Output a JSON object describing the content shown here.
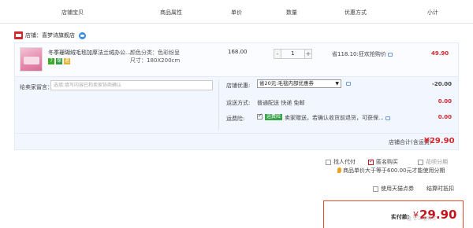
{
  "header": {
    "col_item": "店铺宝贝",
    "col_attr": "商品属性",
    "col_price": "单价",
    "col_qty": "数量",
    "col_discount": "优惠方式",
    "col_subtotal": "小计"
  },
  "store": {
    "label": "店铺：喜梦诗旗舰店"
  },
  "item": {
    "title": "冬季珊瑚绒毛毯加厚法兰绒办公...",
    "badges": [
      "7",
      "保",
      "退"
    ],
    "color": "颜色分类：色彩纷呈",
    "size": "尺寸：180X200cm",
    "price": "168.00",
    "qty_minus": "-",
    "qty_value": "1",
    "qty_plus": "+",
    "saving": "省118.10:狂欢抢购价",
    "subtotal": "49.90"
  },
  "message": {
    "label": "给卖家留言：",
    "placeholder": "选填:填写内容已和卖家协商确认"
  },
  "coupon": {
    "label": "店铺优惠:",
    "selected": "省20元:毛毯内部优惠券",
    "amount": "-20.00"
  },
  "shipping": {
    "label": "运送方式:",
    "text": "普通配送 快递 免邮",
    "amount": "0.00"
  },
  "insurance": {
    "label": "运费险:",
    "tag": "运费险",
    "text": "卖家赠送，若确认收货前退货，可获保...",
    "amount": "0.00"
  },
  "total": {
    "label": "店铺合计(含运费)",
    "value": "¥29.90"
  },
  "options": {
    "pay_for_other": "找人代付",
    "anonymous": "匿名购买",
    "huabei": "花呗分期",
    "huabei_tip": "商品单价大于等于600.00元才能使用分期",
    "tmall_points": "使用天猫点券",
    "settle": "结算时抵扣"
  },
  "final": {
    "label": "实付款:",
    "currency": "¥",
    "value": "29.90"
  },
  "watermark": "值 什么值得买"
}
